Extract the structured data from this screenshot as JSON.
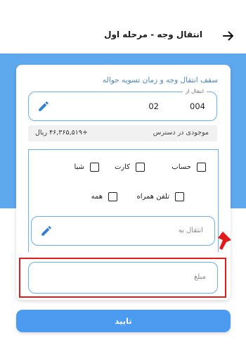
{
  "header": {
    "title": "انتقال وجه - مرحله اول"
  },
  "form": {
    "section_title": "سقف انتقال وجه و زمان تسویه حواله",
    "from_field": {
      "legend": "انتقال از",
      "code_a": "004",
      "code_b": "02"
    },
    "balance": {
      "label": "موجودی در دسترس",
      "value": "+۴۶,۳۶۵,۵۱۹ ریال"
    },
    "options": [
      {
        "label": "حساب",
        "checked": false
      },
      {
        "label": "کارت",
        "checked": false
      },
      {
        "label": "شبا",
        "checked": false
      },
      {
        "label": "تلفن همراه",
        "checked": false
      },
      {
        "label": "همه",
        "checked": false
      }
    ],
    "to_field": {
      "placeholder": "انتقال به"
    },
    "amount_field": {
      "placeholder": "مبلغ"
    }
  },
  "confirm_button": {
    "label": "تایید"
  },
  "colors": {
    "primary": "#4b9cf0",
    "band": "#5ea8ee",
    "field_border": "#6aaef0",
    "highlight": "#e21b1b"
  },
  "icons": {
    "back": "arrow-right-icon",
    "edit": "pencil-icon",
    "annotation": "red-arrow-icon"
  }
}
